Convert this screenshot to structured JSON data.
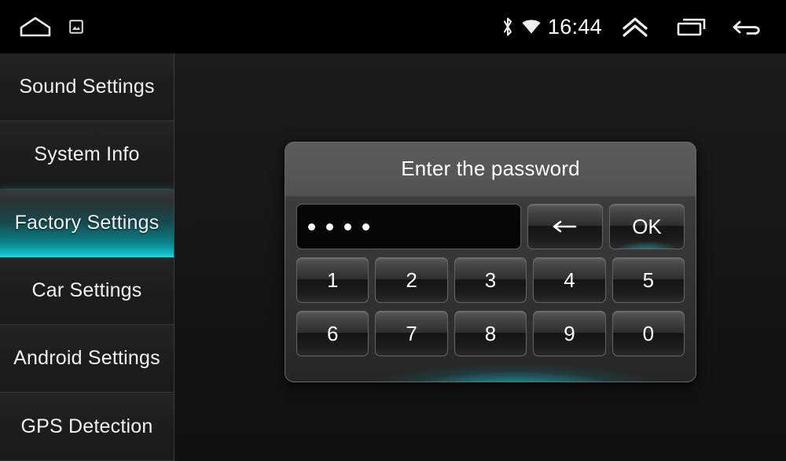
{
  "status_bar": {
    "time": "16:44",
    "left_icons": [
      {
        "name": "home-icon",
        "label": "Home"
      },
      {
        "name": "screenshot-icon",
        "label": "Screenshot"
      }
    ],
    "indicators": [
      {
        "name": "bluetooth-icon",
        "label": "Bluetooth"
      },
      {
        "name": "wifi-icon",
        "label": "Wi-Fi"
      }
    ],
    "nav_icons": [
      {
        "name": "chevron-double-up-icon",
        "label": "Expand"
      },
      {
        "name": "recent-apps-icon",
        "label": "Recent apps"
      },
      {
        "name": "back-icon",
        "label": "Back"
      }
    ]
  },
  "sidebar": {
    "items": [
      {
        "label": "Sound Settings",
        "active": false
      },
      {
        "label": "System Info",
        "active": false
      },
      {
        "label": "Factory Settings",
        "active": true
      },
      {
        "label": "Car Settings",
        "active": false
      },
      {
        "label": "Android Settings",
        "active": false
      },
      {
        "label": "GPS Detection",
        "active": false
      }
    ]
  },
  "dialog": {
    "title": "Enter the password",
    "password_value": "••••",
    "password_dot_count": 4,
    "actions": {
      "backspace_label": "←",
      "backspace_icon": "arrow-left-icon",
      "ok_label": "OK"
    },
    "keypad_rows": [
      [
        "1",
        "2",
        "3",
        "4",
        "5"
      ],
      [
        "6",
        "7",
        "8",
        "9",
        "0"
      ]
    ]
  },
  "colors": {
    "accent_cyan": "#1ad0da",
    "accent_cyan_bright": "#2de8f0",
    "background": "#101010",
    "sidebar_bg": "#1e1e1e",
    "dialog_bg": "#343434",
    "text": "#f2f2f2"
  }
}
